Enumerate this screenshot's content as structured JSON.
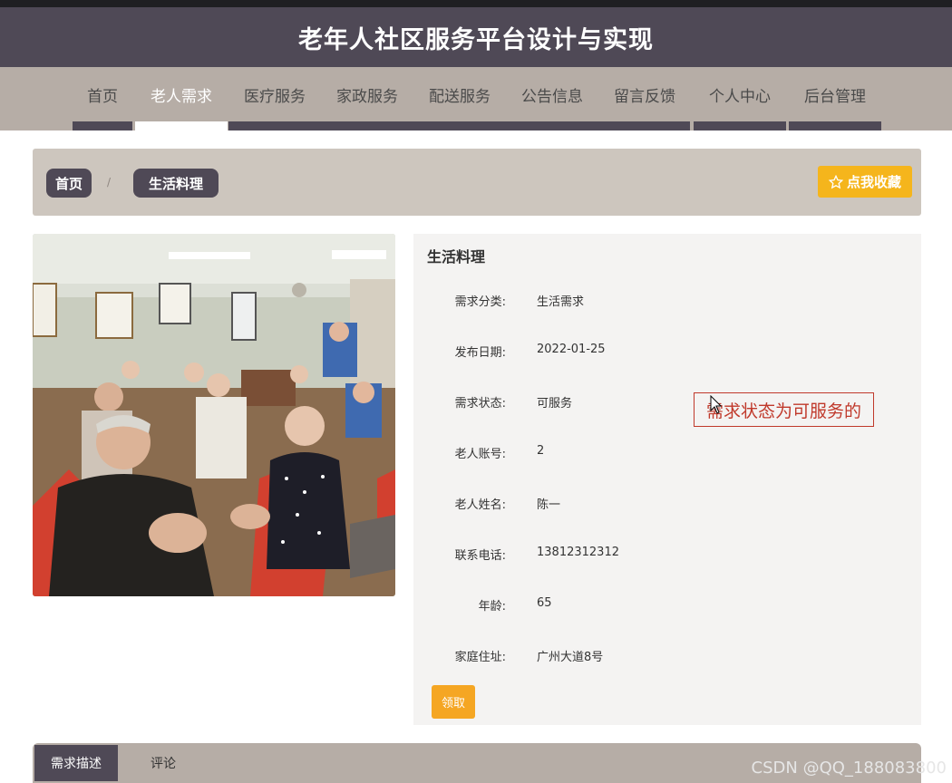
{
  "header": {
    "title": "老年人社区服务平台设计与实现"
  },
  "nav": {
    "items": [
      {
        "label": "首页"
      },
      {
        "label": "老人需求"
      },
      {
        "label": "医疗服务"
      },
      {
        "label": "家政服务"
      },
      {
        "label": "配送服务"
      },
      {
        "label": "公告信息"
      },
      {
        "label": "留言反馈"
      },
      {
        "label": "个人中心"
      },
      {
        "label": "后台管理"
      }
    ],
    "active": "老人需求"
  },
  "breadcrumb": {
    "home": "首页",
    "separator": "/",
    "current": "生活料理",
    "favorite_label": "点我收藏"
  },
  "detail": {
    "title": "生活料理",
    "fields": [
      {
        "label": "需求分类:",
        "value": "生活需求"
      },
      {
        "label": "发布日期:",
        "value": "2022-01-25"
      },
      {
        "label": "需求状态:",
        "value": "可服务"
      },
      {
        "label": "老人账号:",
        "value": "2"
      },
      {
        "label": "老人姓名:",
        "value": "陈一"
      },
      {
        "label": "联系电话:",
        "value": "13812312312"
      },
      {
        "label": "年龄:",
        "value": "65"
      },
      {
        "label": "家庭住址:",
        "value": "广州大道8号"
      }
    ],
    "claim_label": "领取",
    "annotation": "需求状态为可服务的"
  },
  "tabs": [
    {
      "label": "需求描述"
    },
    {
      "label": "评论"
    }
  ],
  "watermark": "CSDN @QQ_188083800",
  "colors": {
    "header_bg": "#4f4956",
    "nav_bg": "#b6ada6",
    "accent": "#f5b51c",
    "claim": "#f5a623"
  }
}
